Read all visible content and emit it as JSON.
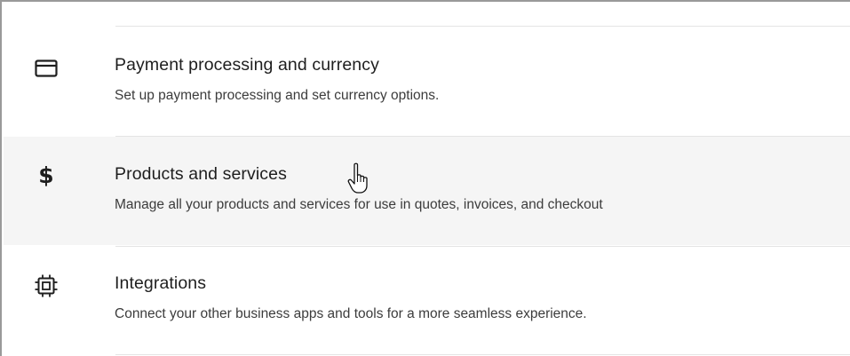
{
  "settings_list": {
    "items": [
      {
        "icon": "credit-card-icon",
        "title": "Payment processing and currency",
        "description": "Set up payment processing and set currency options."
      },
      {
        "icon": "dollar-sign-icon",
        "icon_glyph": "$",
        "title": "Products and services",
        "description": "Manage all your products and services for use in quotes, invoices, and checkout"
      },
      {
        "icon": "chip-icon",
        "title": "Integrations",
        "description": "Connect your other business apps and tools for a more seamless experience."
      }
    ]
  },
  "colors": {
    "hover_background": "#f5f5f5",
    "divider": "#e4e4e4",
    "title_text": "#1e1e1e",
    "description_text": "#3c3c3c"
  }
}
